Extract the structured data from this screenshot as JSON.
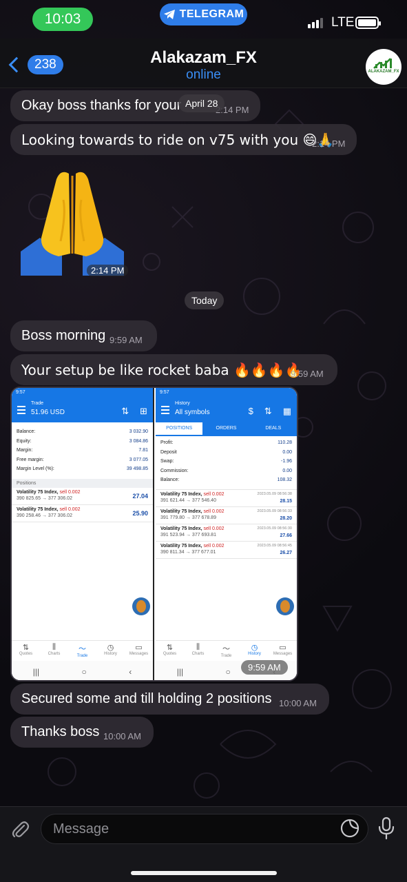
{
  "status_bar": {
    "time": "10:03",
    "app_badge": "TELEGRAM",
    "network": "LTE"
  },
  "header": {
    "back_count": "238",
    "title": "Alakazam_FX",
    "status": "online",
    "avatar_text": "ALAKAZAM_FX"
  },
  "messages": [
    {
      "text": "Okay boss thanks for your",
      "time": "2:14 PM"
    },
    {
      "text": "Looking towards to ride on v75 with you 😄🙏",
      "time": "2:14 PM"
    },
    {
      "sticker": "folded-hands",
      "time": "2:14 PM"
    },
    {
      "text": "Boss morning",
      "time": "9:59 AM"
    },
    {
      "text": "Your setup be like rocket baba 🔥🔥🔥🔥",
      "time": "9:59 AM"
    },
    {
      "image_time": "9:59 AM"
    },
    {
      "text": "Secured some and till holding 2 positions",
      "time": "10:00 AM"
    },
    {
      "text": "Thanks boss",
      "time": "10:00 AM"
    }
  ],
  "date_chips": {
    "floating": "April 28",
    "today": "Today"
  },
  "screenshot": {
    "status_time": "9:57",
    "trade": {
      "header_small": "Trade",
      "header_value": "51.96 USD",
      "rows": [
        {
          "k": "Balance:",
          "v": "3 032.90"
        },
        {
          "k": "Equity:",
          "v": "3 084.86"
        },
        {
          "k": "Margin:",
          "v": "7.81"
        },
        {
          "k": "Free margin:",
          "v": "3 077.05"
        },
        {
          "k": "Margin Level (%):",
          "v": "39 498.85"
        }
      ],
      "section": "Positions",
      "positions": [
        {
          "name": "Volatility 75 Index,",
          "side": "sell 0.002",
          "prices": "390 825.65 → 377 306.02",
          "pl": "27.04"
        },
        {
          "name": "Volatility 75 Index,",
          "side": "sell 0.002",
          "prices": "390 258.46 → 377 306.02",
          "pl": "25.90"
        }
      ]
    },
    "history": {
      "header_small": "History",
      "header_value": "All symbols",
      "tabs": [
        "POSITIONS",
        "ORDERS",
        "DEALS"
      ],
      "rows": [
        {
          "k": "Profit:",
          "v": "110.28"
        },
        {
          "k": "Deposit",
          "v": "0.00"
        },
        {
          "k": "Swap:",
          "v": "-1.96"
        },
        {
          "k": "Commission:",
          "v": "0.00"
        },
        {
          "k": "Balance:",
          "v": "108.32"
        }
      ],
      "deals": [
        {
          "name": "Volatility 75 Index,",
          "side": "sell 0.002",
          "prices": "391 621.44 → 377 546.40",
          "date": "2023.05.09 08:56:38",
          "pl": "28.15"
        },
        {
          "name": "Volatility 75 Index,",
          "side": "sell 0.002",
          "prices": "391 779.80 → 377 678.89",
          "date": "2023.05.09 08:56:33",
          "pl": "28.20"
        },
        {
          "name": "Volatility 75 Index,",
          "side": "sell 0.002",
          "prices": "391 523.94 → 377 693.81",
          "date": "2023.05.09 08:56:30",
          "pl": "27.66"
        },
        {
          "name": "Volatility 75 Index,",
          "side": "sell 0.002",
          "prices": "390 811.34 → 377 677.01",
          "date": "2023.05.09 08:56:45",
          "pl": "26.27"
        }
      ]
    },
    "nav": [
      "Quotes",
      "Charts",
      "Trade",
      "History",
      "Messages"
    ]
  },
  "input": {
    "placeholder": "Message"
  },
  "colors": {
    "accent": "#2f7de9",
    "status_pill": "#34c759",
    "bubble": "#302c34"
  }
}
